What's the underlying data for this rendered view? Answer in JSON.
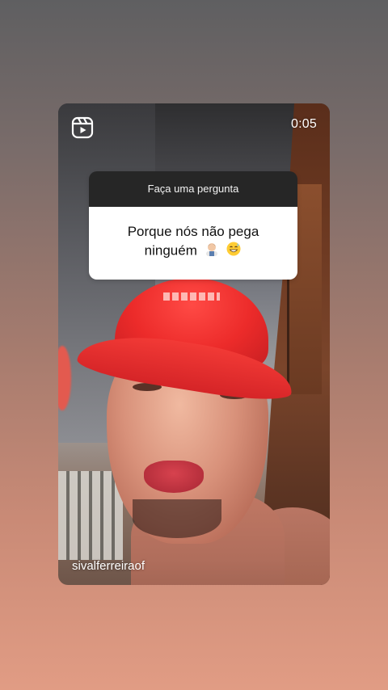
{
  "story": {
    "timer": "0:05",
    "username": "sivalferreiraof",
    "icon": "reels-icon"
  },
  "question_sticker": {
    "header": "Faça uma pergunta",
    "line1": "Porque nós não pega",
    "line2": "ninguém",
    "emojis": [
      "man-technologist-emoji",
      "grinning-sweat-emoji"
    ]
  },
  "colors": {
    "cap_red": "#ec2b2a",
    "sticker_header_bg": "#262626",
    "sticker_body_bg": "#ffffff"
  }
}
